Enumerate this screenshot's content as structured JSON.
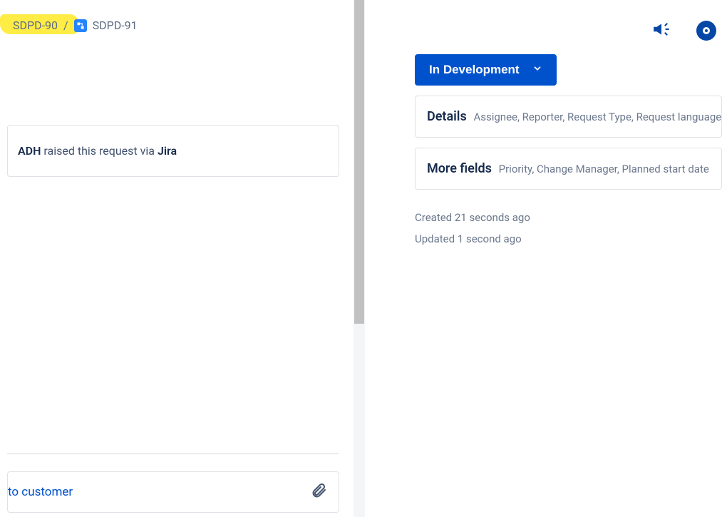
{
  "breadcrumb": {
    "parent_key": "SDPD-90",
    "separator": "/",
    "child_key": "SDPD-91"
  },
  "request_line": {
    "actor": "ADH",
    "middle": " raised this request via ",
    "source": "Jira"
  },
  "reply": {
    "label": "to customer"
  },
  "status": {
    "label": "In Development"
  },
  "details_panel": {
    "title": "Details",
    "summary": "Assignee, Reporter, Request Type, Request language"
  },
  "more_fields_panel": {
    "title": "More fields",
    "summary": "Priority, Change Manager, Planned start date"
  },
  "meta": {
    "created": "Created 21 seconds ago",
    "updated": "Updated 1 second ago"
  }
}
